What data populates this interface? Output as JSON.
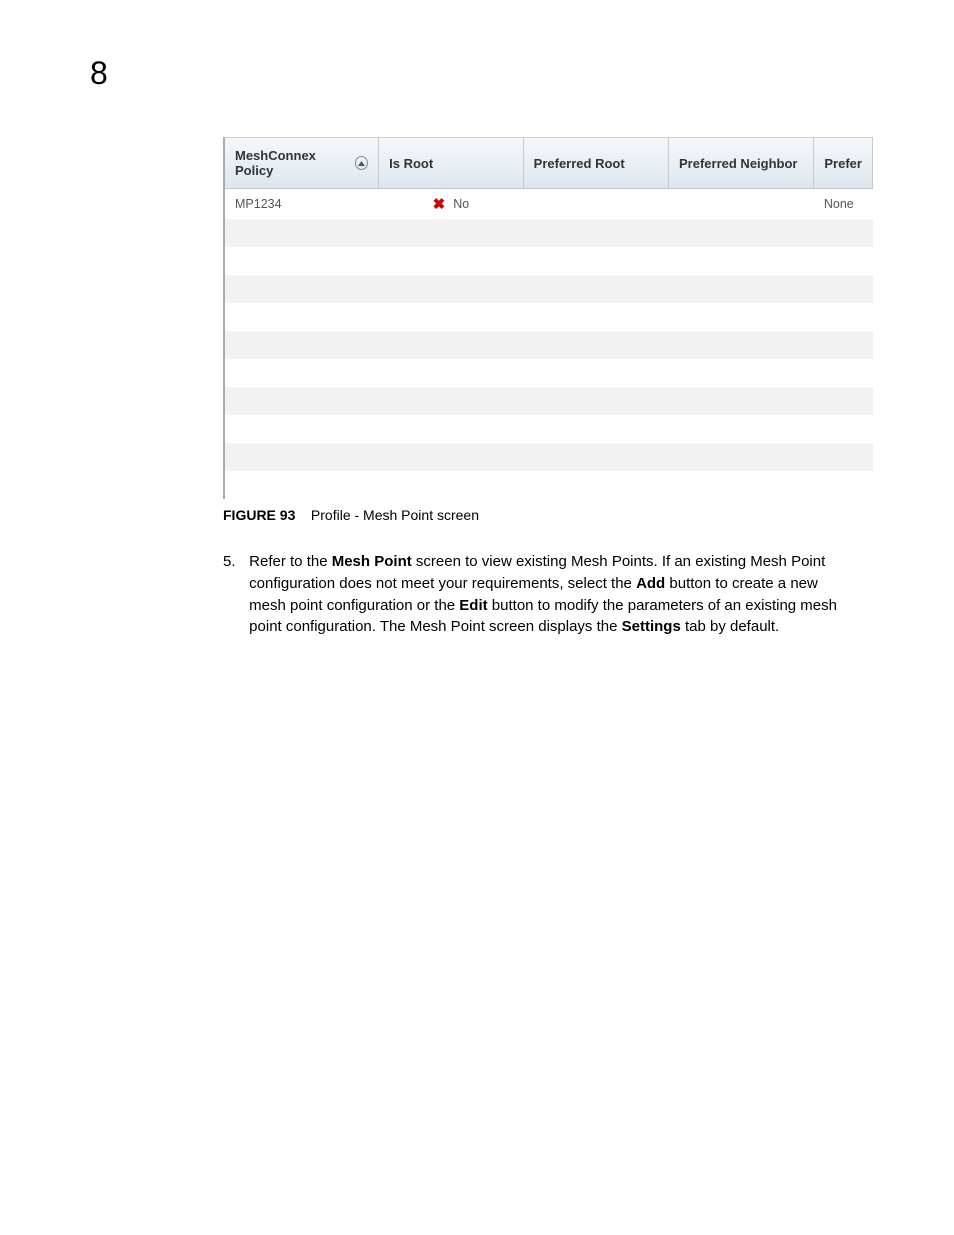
{
  "chapter": "8",
  "table": {
    "headers": {
      "col1": "MeshConnex Policy",
      "col2": "Is Root",
      "col3": "Preferred Root",
      "col4": "Preferred Neighbor",
      "col5": "Prefer"
    },
    "rows": [
      {
        "policy": "MP1234",
        "is_root_icon": "x",
        "is_root_text": "No",
        "pref_root": "",
        "pref_neighbor": "",
        "prefer": "None"
      },
      {
        "policy": "",
        "is_root_icon": "",
        "is_root_text": "",
        "pref_root": "",
        "pref_neighbor": "",
        "prefer": ""
      },
      {
        "policy": "",
        "is_root_icon": "",
        "is_root_text": "",
        "pref_root": "",
        "pref_neighbor": "",
        "prefer": ""
      },
      {
        "policy": "",
        "is_root_icon": "",
        "is_root_text": "",
        "pref_root": "",
        "pref_neighbor": "",
        "prefer": ""
      },
      {
        "policy": "",
        "is_root_icon": "",
        "is_root_text": "",
        "pref_root": "",
        "pref_neighbor": "",
        "prefer": ""
      },
      {
        "policy": "",
        "is_root_icon": "",
        "is_root_text": "",
        "pref_root": "",
        "pref_neighbor": "",
        "prefer": ""
      },
      {
        "policy": "",
        "is_root_icon": "",
        "is_root_text": "",
        "pref_root": "",
        "pref_neighbor": "",
        "prefer": ""
      },
      {
        "policy": "",
        "is_root_icon": "",
        "is_root_text": "",
        "pref_root": "",
        "pref_neighbor": "",
        "prefer": ""
      },
      {
        "policy": "",
        "is_root_icon": "",
        "is_root_text": "",
        "pref_root": "",
        "pref_neighbor": "",
        "prefer": ""
      },
      {
        "policy": "",
        "is_root_icon": "",
        "is_root_text": "",
        "pref_root": "",
        "pref_neighbor": "",
        "prefer": ""
      },
      {
        "policy": "",
        "is_root_icon": "",
        "is_root_text": "",
        "pref_root": "",
        "pref_neighbor": "",
        "prefer": ""
      }
    ]
  },
  "caption": {
    "label": "FIGURE 93",
    "text": "Profile - Mesh Point screen"
  },
  "step": {
    "num": "5.",
    "t1": "Refer to the ",
    "b1": "Mesh Point",
    "t2": " screen to view existing Mesh Points. If an existing Mesh Point configuration does not meet your requirements, select the ",
    "b2": "Add",
    "t3": " button to create a new mesh point configuration or the ",
    "b3": "Edit",
    "t4": " button to modify the parameters of an existing mesh point configuration. The Mesh Point screen displays the ",
    "b4": "Settings",
    "t5": " tab by default."
  }
}
